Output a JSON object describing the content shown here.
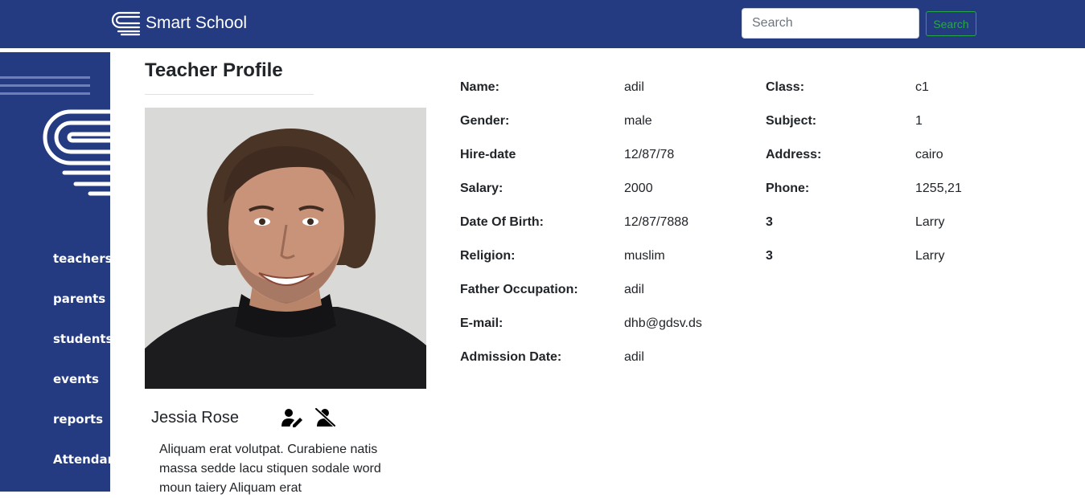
{
  "navbar": {
    "brand": "Smart School",
    "search_placeholder": "Search",
    "search_button": "Search"
  },
  "sidebar": {
    "items": [
      "teachers",
      "parents",
      "students",
      "events",
      "reports",
      "Attendance"
    ]
  },
  "profile": {
    "title": "Teacher Profile",
    "name": "Jessia Rose",
    "bio": "Aliquam erat volutpat. Curabiene natis massa sedde lacu stiquen sodale word moun taiery Aliquam erat"
  },
  "details": {
    "left": [
      {
        "label": "Name:",
        "value": "adil"
      },
      {
        "label": "Gender:",
        "value": "male"
      },
      {
        "label": "Hire-date",
        "value": "12/87/78"
      },
      {
        "label": "Salary:",
        "value": "2000"
      },
      {
        "label": "Date Of Birth:",
        "value": "12/87/7888"
      },
      {
        "label": "Religion:",
        "value": "muslim"
      },
      {
        "label": "Father Occupation:",
        "value": "adil"
      },
      {
        "label": "E-mail:",
        "value": "dhb@gdsv.ds"
      },
      {
        "label": "Admission Date:",
        "value": "adil"
      }
    ],
    "right": [
      {
        "label": "Class:",
        "value": "c1"
      },
      {
        "label": "Subject:",
        "value": "1"
      },
      {
        "label": "Address:",
        "value": "cairo"
      },
      {
        "label": "Phone:",
        "value": "1255,21"
      },
      {
        "label": "3",
        "value": "Larry"
      },
      {
        "label": "3",
        "value": "Larry"
      }
    ]
  },
  "icons": {
    "brand_logo": "school-logo-icon",
    "edit": "user-edit-icon",
    "delete": "user-remove-icon"
  },
  "colors": {
    "primary": "#243b82",
    "success": "#28a745"
  }
}
